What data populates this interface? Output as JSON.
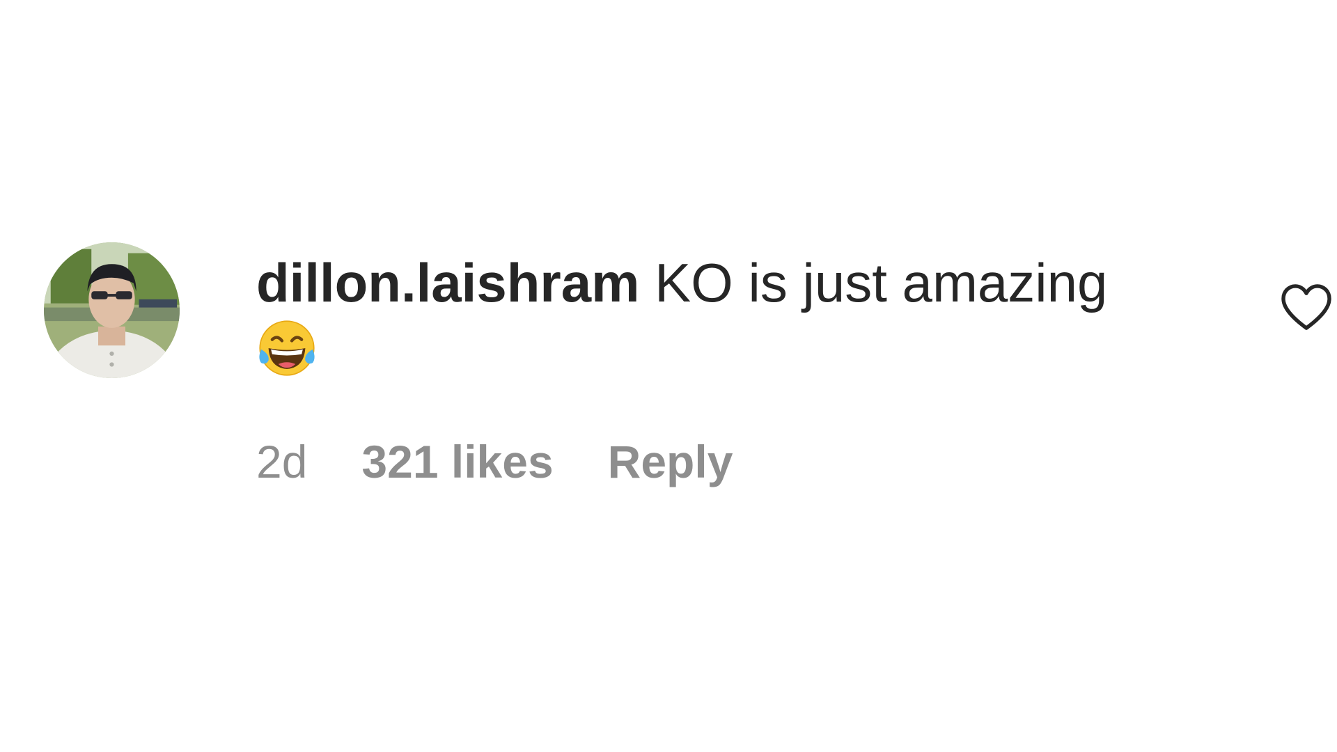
{
  "comment": {
    "username": "dillon.laishram",
    "text": "KO is just amazing",
    "emoji": "face-with-tears-of-joy",
    "time": "2d",
    "likes": "321 likes",
    "reply_label": "Reply"
  },
  "icons": {
    "like": "heart-outline-icon"
  },
  "colors": {
    "text": "#262626",
    "meta": "#8e8e8e",
    "background": "#ffffff"
  }
}
